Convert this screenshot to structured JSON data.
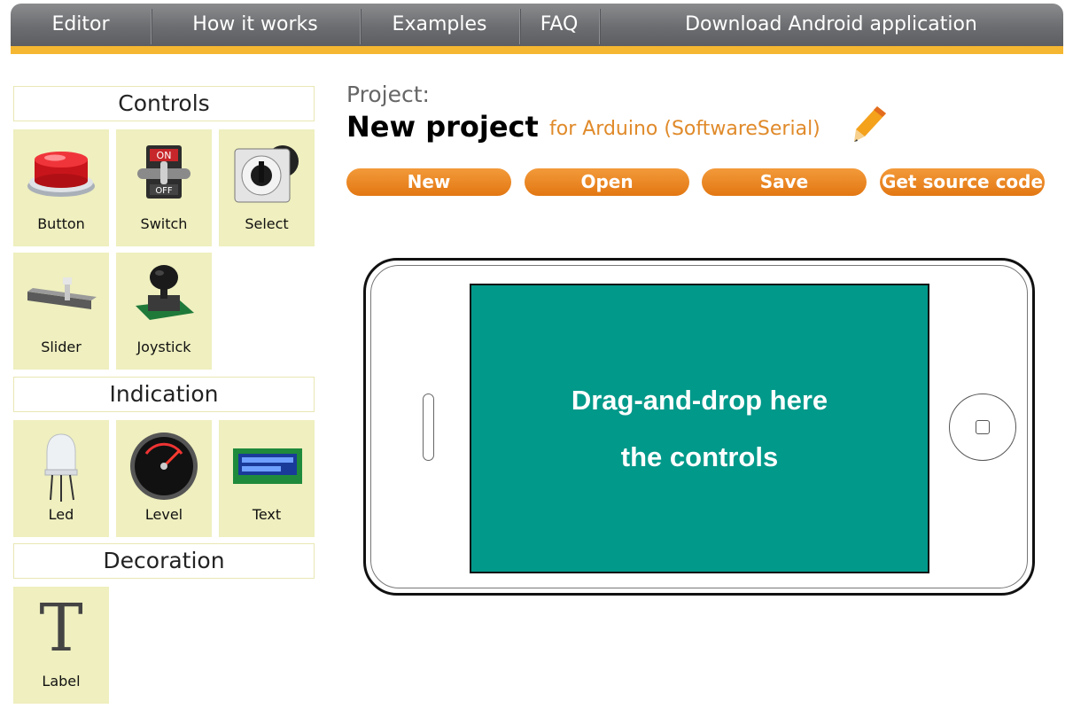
{
  "nav": {
    "items": [
      {
        "label": "Editor"
      },
      {
        "label": "How it works"
      },
      {
        "label": "Examples"
      },
      {
        "label": "FAQ"
      },
      {
        "label": "Download Android application"
      }
    ]
  },
  "palette": {
    "controls_title": "Controls",
    "controls": [
      "Button",
      "Switch",
      "Select",
      "Slider",
      "Joystick"
    ],
    "indication_title": "Indication",
    "indication": [
      "Led",
      "Level",
      "Text"
    ],
    "decoration_title": "Decoration",
    "decoration": [
      "Label"
    ],
    "label_glyph": "T"
  },
  "project": {
    "label": "Project:",
    "name": "New project",
    "target": "for Arduino (SoftwareSerial)"
  },
  "toolbar": {
    "new_label": "New",
    "open_label": "Open",
    "save_label": "Save",
    "source_label": "Get source code"
  },
  "canvas": {
    "line1": "Drag-and-drop here",
    "line2": "the controls"
  },
  "colors": {
    "accent_orange": "#e27712",
    "nav_stripe": "#f5b731",
    "screen_teal": "#00998a",
    "tile_bg": "#efefbf"
  }
}
